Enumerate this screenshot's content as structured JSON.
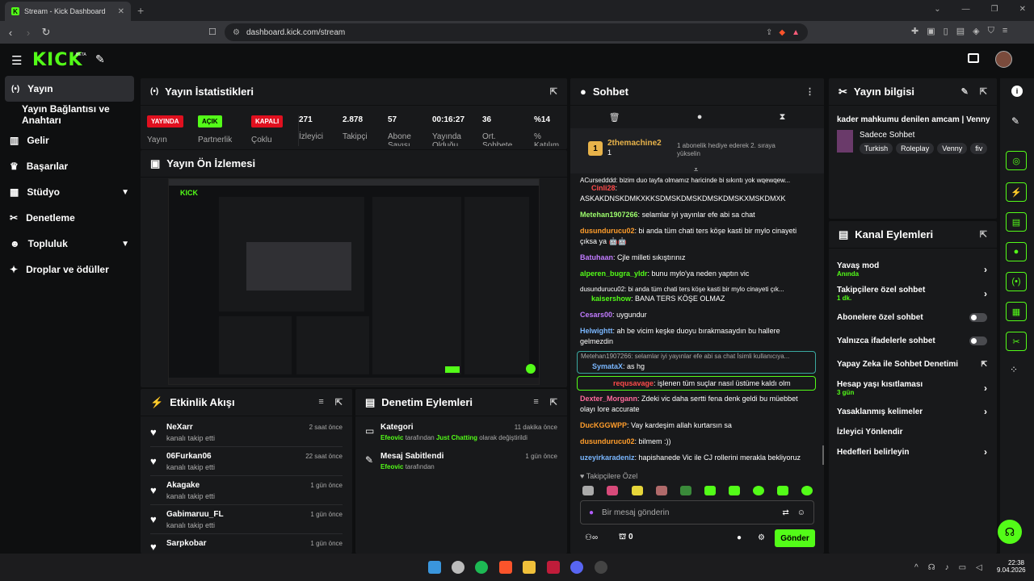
{
  "browser": {
    "tab_title": "Stream - Kick Dashboard",
    "url": "dashboard.kick.com/stream"
  },
  "app": {
    "logo": "KICK",
    "logo_sup": "BETA"
  },
  "sidebar": {
    "items": [
      {
        "label": "Yayın",
        "icon": "broadcast-icon"
      },
      {
        "label": "Yayın Bağlantısı ve Anahtarı"
      },
      {
        "label": "Gelir",
        "icon": "chart-icon"
      },
      {
        "label": "Başarılar",
        "icon": "trophy-icon"
      },
      {
        "label": "Stüdyo",
        "icon": "studio-icon"
      },
      {
        "label": "Denetleme",
        "icon": "wrench-icon"
      },
      {
        "label": "Topluluk",
        "icon": "community-icon"
      },
      {
        "label": "Droplar ve ödüller",
        "icon": "gift-icon"
      }
    ]
  },
  "stats": {
    "title": "Yayın İstatistikleri",
    "items": [
      {
        "badge": "YAYINDA",
        "label": "Yayın"
      },
      {
        "badge": "AÇIK",
        "label": "Partnerlik"
      },
      {
        "badge": "KAPALI",
        "label": "Çoklu"
      },
      {
        "value": "271",
        "label": "İzleyici"
      },
      {
        "value": "2.878",
        "label": "Takipçi"
      },
      {
        "value": "57",
        "label": "Abone Sayısı"
      },
      {
        "value": "00:16:27",
        "label": "Yayında Olduğu"
      },
      {
        "value": "36",
        "label": "Ort. Sohbete"
      },
      {
        "value": "%14",
        "label": "% Katılım"
      }
    ]
  },
  "preview": {
    "title": "Yayın Ön İzlemesi"
  },
  "activity": {
    "title": "Etkinlik Akışı",
    "items": [
      {
        "name": "NeXarr",
        "action": "kanalı takip etti",
        "time": "2 saat önce"
      },
      {
        "name": "06Furkan06",
        "action": "kanalı takip etti",
        "time": "22 saat önce"
      },
      {
        "name": "Akagake",
        "action": "kanalı takip etti",
        "time": "1 gün önce"
      },
      {
        "name": "Gabimaruu_FL",
        "action": "kanalı takip etti",
        "time": "1 gün önce"
      },
      {
        "name": "Sarpkobar",
        "action": "",
        "time": "1 gün önce"
      }
    ]
  },
  "modlog": {
    "title": "Denetim Eylemleri",
    "items": [
      {
        "title": "Kategori",
        "user": "Efeovic",
        "mid": " tarafından ",
        "cat": "Just Chatting",
        "tail": " olarak değiştirildi",
        "time": "11 dakika önce"
      },
      {
        "title": "Mesaj Sabitlendi",
        "user": "Efeovic",
        "mid": " tarafından",
        "cat": "",
        "tail": "",
        "time": "1 gün önce"
      }
    ]
  },
  "chat": {
    "title": "Sohbet",
    "top_gifter": {
      "name": "2themachine2",
      "count": "1",
      "rank": "1",
      "note": "1 abonelik hediye ederek 2. sıraya yükselin"
    },
    "messages": [
      {
        "reply": "ACursedddd: bizim duo tayfa olmamız haricinde bi sıkıntı yok wqewqew...",
        "user": "Cinli28",
        "color": "#ff4b4b",
        "text": ""
      },
      {
        "user": "",
        "color": "#fff",
        "text": "ASKAKDNSKDMKXKKSDMSKDMSKDMSKDMSKXMSKDMXK"
      },
      {
        "user": "Metehan1907266",
        "color": "#9cfc6c",
        "text": "selamlar iyi yayınlar efe abi sa chat"
      },
      {
        "user": "dusundurucu02",
        "color": "#ff9d2b",
        "text": "bi anda tüm chati ters köşe kasti bir mylo cinayeti çıksa ya 🤖🤖"
      },
      {
        "user": "Batuhaan",
        "color": "#c17bff",
        "text": "Cjle milleti sıkıştırınız"
      },
      {
        "user": "alperen_bugra_yldr",
        "color": "#53fc18",
        "text": "bunu mylo'ya neden yaptın vic"
      },
      {
        "reply": "dusundurucu02: bi anda tüm chati ters köşe kasti bir mylo cinayeti çık...",
        "user": "kaisershow",
        "color": "#53fc18",
        "text": "BANA TERS KÖŞE OLMAZ"
      },
      {
        "user": "Cesars00",
        "color": "#c17bff",
        "text": "uygundur"
      },
      {
        "user": "Helwightt",
        "color": "#7ab7ff",
        "text": "ah be vicim keşke duoyu bırakmasaydın bu hallere gelmezdin"
      },
      {
        "reply": "Metehan1907266: selamlar iyi yayınlar efe abi sa chat İsimli kullanıcıya...",
        "user": "SymataX",
        "color": "#7ab7ff",
        "text": "as hg"
      },
      {
        "user": "requsavage",
        "color": "#ff4b4b",
        "text": "işlenen tüm suçlar nasıl üstüme kaldı olm"
      },
      {
        "user": "Dexter_Morgann",
        "color": "#ff6b9c",
        "text": "Zdeki vic daha sertti fena denk geldi bu müebbet olayı lore accurate"
      },
      {
        "user": "DucKGGWPP",
        "color": "#ff9d2b",
        "text": "Vay kardeşim allah kurtarsın sa"
      },
      {
        "user": "dusundurucu02",
        "color": "#ff9d2b",
        "text": "bilmem :))"
      },
      {
        "user": "uzeyirkaradeniz",
        "color": "#7ab7ff",
        "text": "hapishanede Vic ile CJ rollerini merakla bekliyoruz"
      }
    ],
    "followers_only": "Takipçilere Özel",
    "input_placeholder": "Bir mesaj gönderin",
    "points": "0",
    "send_label": "Gönder"
  },
  "stream_info": {
    "title": "Yayın bilgisi",
    "stream_title": "kader mahkumu denilen amcam | Venny",
    "category": "Sadece Sohbet",
    "tags": [
      "Turkish",
      "Roleplay",
      "Venny",
      "fiv"
    ]
  },
  "channel_actions": {
    "title": "Kanal Eylemleri",
    "items": [
      {
        "label": "Yavaş mod",
        "sub": "Anında",
        "control": "chevron"
      },
      {
        "label": "Takipçilere özel sohbet",
        "sub": "1 dk.",
        "control": "chevron"
      },
      {
        "label": "Abonelere özel sohbet",
        "sub": "",
        "control": "toggle"
      },
      {
        "label": "Yalnızca ifadelerle sohbet",
        "sub": "",
        "control": "toggle"
      },
      {
        "label": "Yapay Zeka ile Sohbet Denetimi",
        "sub": "",
        "control": "external"
      },
      {
        "label": "Hesap yaşı kısıtlaması",
        "sub": "3 gün",
        "control": "chevron"
      },
      {
        "label": "Yasaklanmış kelimeler",
        "sub": "",
        "control": "chevron"
      },
      {
        "label": "İzleyici Yönlendir",
        "sub": "",
        "control": "none"
      },
      {
        "label": "Hedefleri belirleyin",
        "sub": "",
        "control": "chevron"
      }
    ]
  },
  "taskbar": {
    "time": "22:38",
    "date": "9.04.2026"
  },
  "colors": {
    "accent": "#53fc18",
    "panel": "#18191b",
    "bg": "#0e0f10",
    "live_red": "#e0101f"
  }
}
